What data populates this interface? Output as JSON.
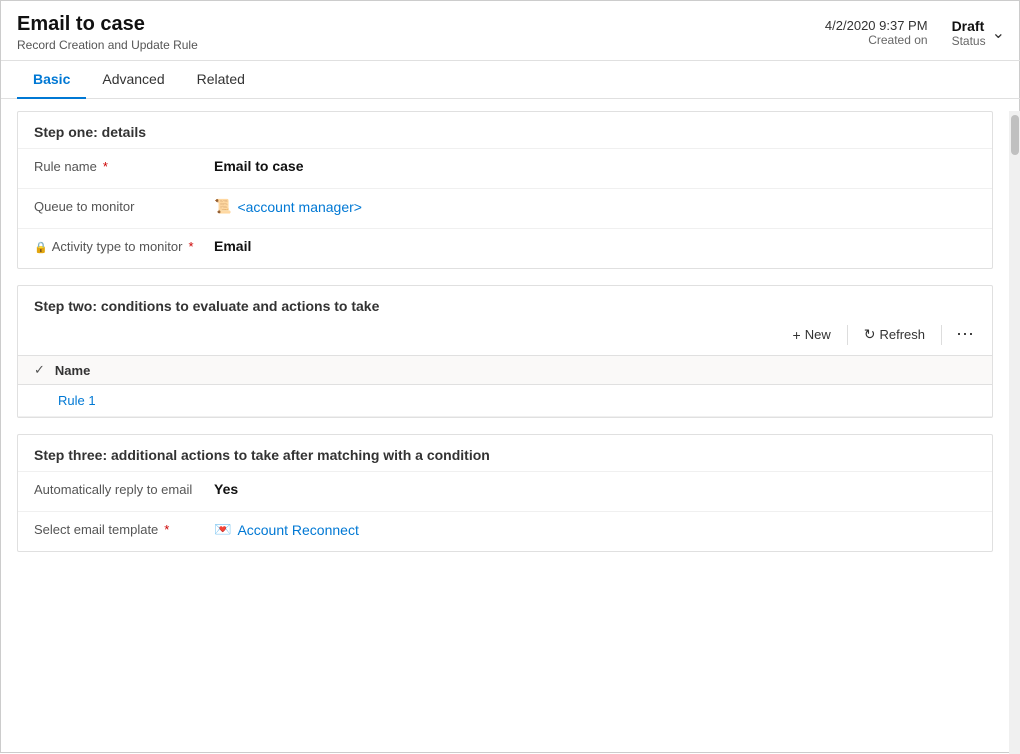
{
  "header": {
    "title": "Email to case",
    "subtitle": "Record Creation and Update Rule",
    "date": "4/2/2020 9:37 PM",
    "created_label": "Created on",
    "status": "Draft",
    "status_label": "Status"
  },
  "tabs": [
    {
      "label": "Basic",
      "active": true
    },
    {
      "label": "Advanced",
      "active": false
    },
    {
      "label": "Related",
      "active": false
    }
  ],
  "step_one": {
    "title": "Step one: details",
    "fields": [
      {
        "label": "Rule name",
        "required": true,
        "lock": false,
        "value": "Email to case",
        "bold": true,
        "link": false
      },
      {
        "label": "Queue to monitor",
        "required": false,
        "lock": false,
        "value": "<account manager>",
        "bold": false,
        "link": true,
        "icon": "queue"
      },
      {
        "label": "Activity type to monitor",
        "required": true,
        "lock": true,
        "value": "Email",
        "bold": true,
        "link": false
      }
    ]
  },
  "step_two": {
    "title": "Step two: conditions to evaluate and actions to take",
    "toolbar": {
      "new_label": "New",
      "refresh_label": "Refresh"
    },
    "grid": {
      "col_name": "Name",
      "rows": [
        {
          "name": "Rule 1"
        }
      ]
    }
  },
  "step_three": {
    "title": "Step three: additional actions to take after matching with a condition",
    "fields": [
      {
        "label": "Automatically reply to email",
        "required": false,
        "lock": false,
        "value": "Yes",
        "bold": true,
        "link": false
      },
      {
        "label": "Select email template",
        "required": true,
        "lock": false,
        "value": "Account Reconnect",
        "bold": false,
        "link": true,
        "icon": "template"
      }
    ]
  }
}
